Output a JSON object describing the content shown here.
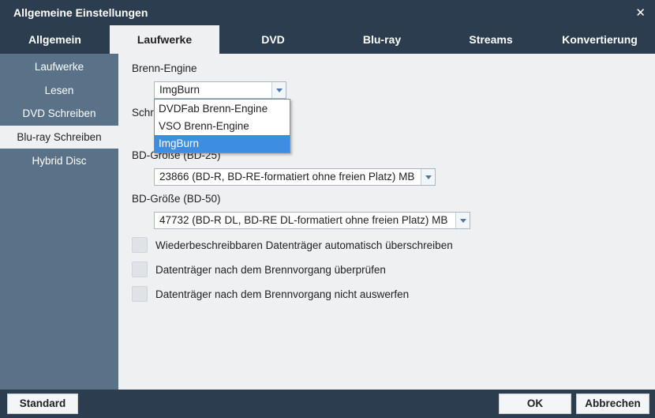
{
  "window": {
    "title": "Allgemeine Einstellungen"
  },
  "tabs": [
    {
      "label": "Allgemein"
    },
    {
      "label": "Laufwerke"
    },
    {
      "label": "DVD"
    },
    {
      "label": "Blu-ray"
    },
    {
      "label": "Streams"
    },
    {
      "label": "Konvertierung"
    }
  ],
  "sidebar": {
    "items": [
      {
        "label": "Laufwerke"
      },
      {
        "label": "Lesen"
      },
      {
        "label": "DVD Schreiben"
      },
      {
        "label": "Blu-ray Schreiben"
      },
      {
        "label": "Hybrid Disc"
      }
    ],
    "active": "Blu-ray Schreiben"
  },
  "brenn_engine": {
    "label": "Brenn-Engine",
    "value": "ImgBurn",
    "options": [
      "DVDFab Brenn-Engine",
      "VSO Brenn-Engine",
      "ImgBurn"
    ]
  },
  "hidden_label_fragment": "Schr",
  "bd25": {
    "label": "BD-Größe (BD-25)",
    "value": "23866 (BD-R, BD-RE-formatiert ohne freien Platz) MB"
  },
  "bd50": {
    "label": "BD-Größe (BD-50)",
    "value": "47732 (BD-R DL, BD-RE DL-formatiert ohne freien Platz) MB"
  },
  "checkboxes": [
    {
      "label": "Wiederbeschreibbaren Datenträger automatisch überschreiben",
      "checked": false
    },
    {
      "label": "Datenträger nach dem Brennvorgang überprüfen",
      "checked": false
    },
    {
      "label": "Datenträger nach dem Brennvorgang nicht auswerfen",
      "checked": false
    }
  ],
  "buttons": {
    "standard": "Standard",
    "ok": "OK",
    "cancel": "Abbrechen"
  },
  "icons": {
    "close": "close-icon",
    "dropdown": "chevron-down-icon"
  }
}
